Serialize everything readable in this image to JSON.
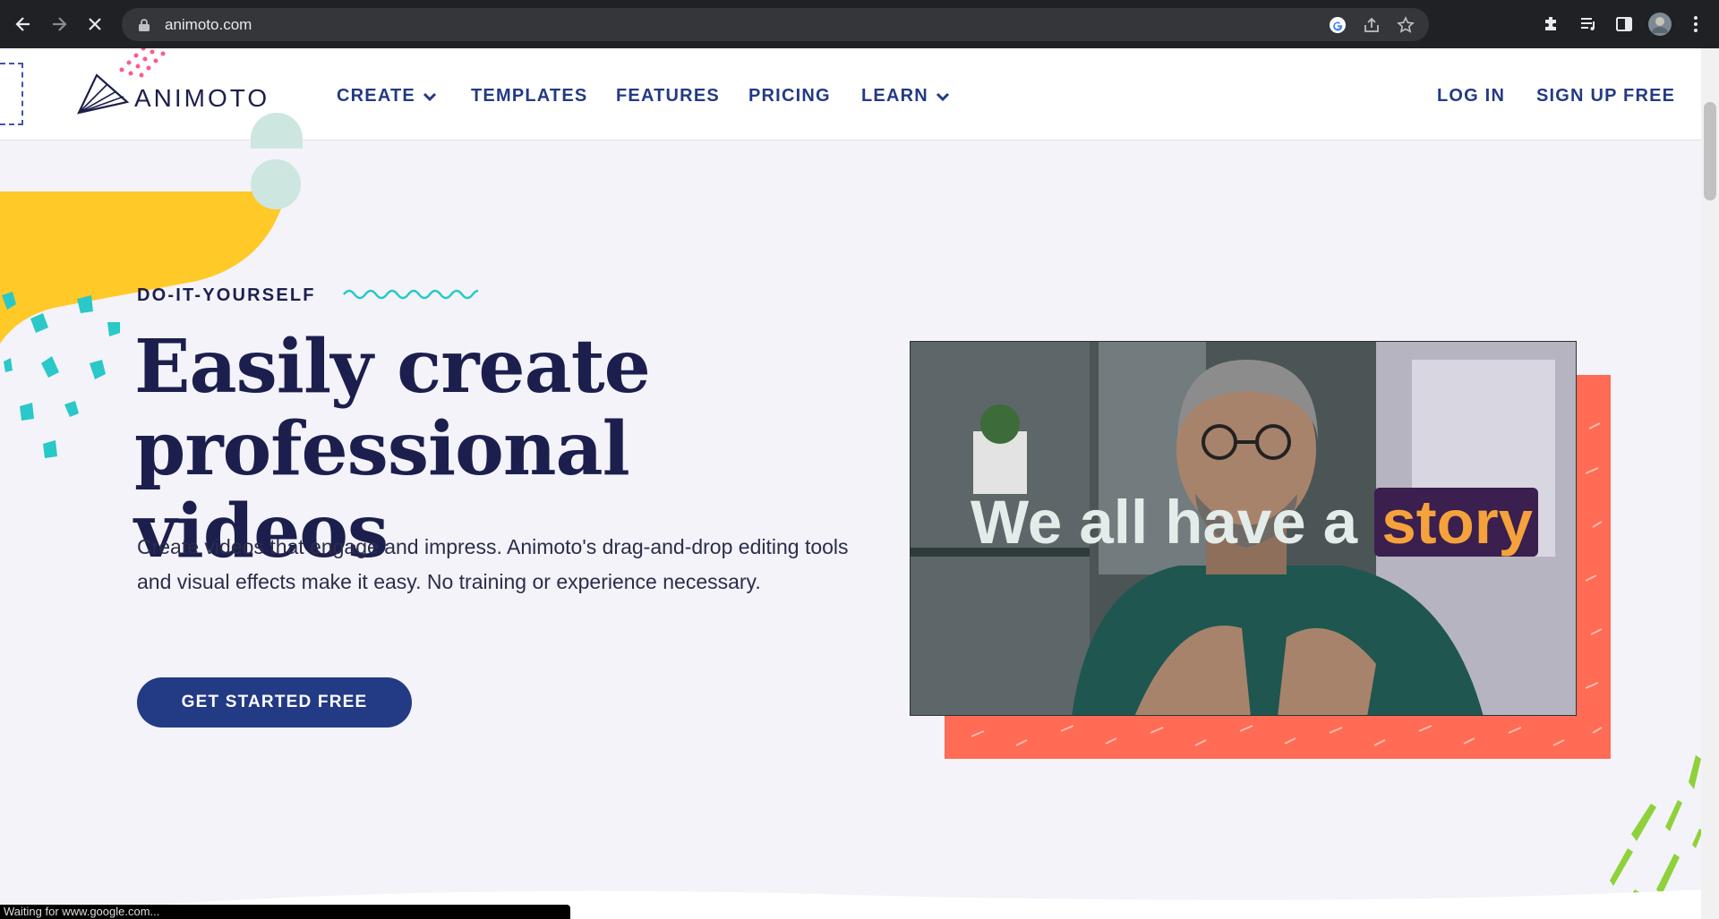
{
  "browser": {
    "url": "animoto.com"
  },
  "nav": {
    "logo": "ANIMOTO",
    "items": [
      {
        "label": "CREATE"
      },
      {
        "label": "TEMPLATES"
      },
      {
        "label": "FEATURES"
      },
      {
        "label": "PRICING"
      },
      {
        "label": "LEARN"
      }
    ],
    "login": "LOG IN",
    "signup": "SIGN UP FREE"
  },
  "hero": {
    "eyebrow": "DO-IT-YOURSELF",
    "headline_line1": "Easily create",
    "headline_line2": "professional videos",
    "body": "Create videos that engage and impress. Animoto's drag-and-drop editing tools and visual effects make it easy. No training or experience necessary.",
    "cta": "GET STARTED FREE"
  },
  "video": {
    "caption_start": "We all have a",
    "caption_highlight": "story"
  },
  "status": "Waiting for www.google.com...",
  "colors": {
    "brand_navy": "#233a85",
    "headline": "#1c1f4d",
    "accent_coral": "#ff6b55",
    "accent_teal": "#2ac8c8",
    "accent_yellow": "#ffc928"
  }
}
